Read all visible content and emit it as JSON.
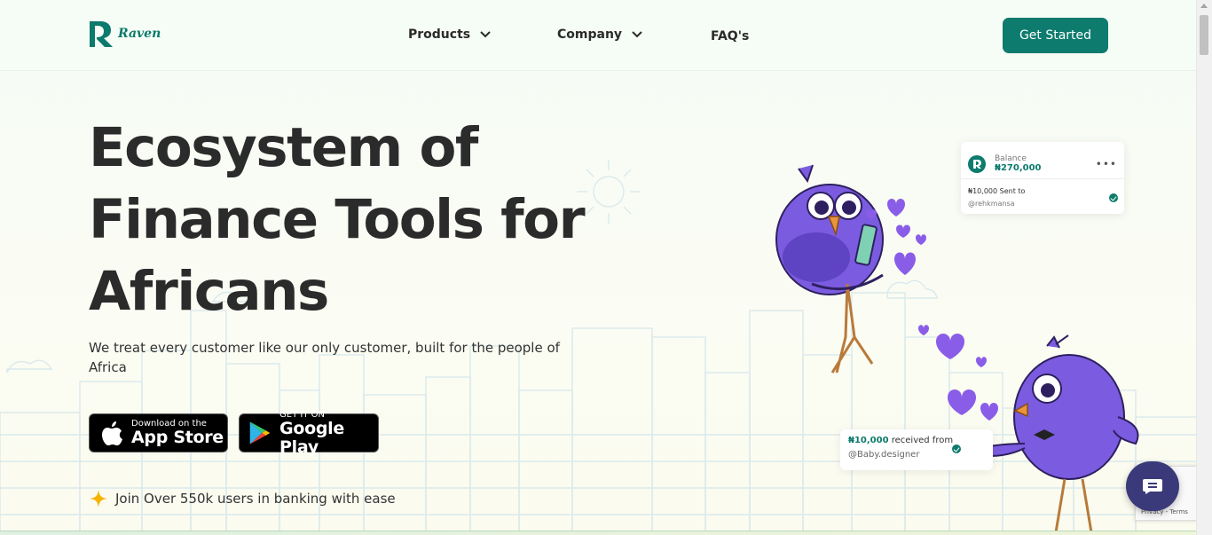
{
  "brand": {
    "name": "Raven",
    "color": "#0d7b6d"
  },
  "nav": {
    "items": [
      {
        "label": "Products",
        "has_dropdown": true
      },
      {
        "label": "Company",
        "has_dropdown": true
      },
      {
        "label": "FAQ's",
        "has_dropdown": false
      }
    ],
    "cta": "Get Started"
  },
  "hero": {
    "title_lines": [
      "Ecosystem of",
      "Finance Tools for",
      "Africans"
    ],
    "subtitle": "We treat every customer like our only customer, built for the people of Africa",
    "app_store": {
      "small": "Download on the",
      "big": "App Store"
    },
    "google_play": {
      "small": "GET IT ON",
      "big": "Google Play"
    },
    "users_text": "Join Over 550k users in banking with ease"
  },
  "balance_card": {
    "label": "Balance",
    "amount": "₦270,000",
    "menu": "•••",
    "transaction": "₦10,000 Sent to",
    "handle": "@rehkmansa"
  },
  "received_card": {
    "amount": "₦10,000",
    "text": "received from",
    "handle": "@Baby.designer"
  },
  "recaptcha": {
    "text": "Privacy - Terms"
  },
  "icons": [
    "raven-logo-icon",
    "chevron-down-icon",
    "apple-icon",
    "google-play-icon",
    "sparkle-icon",
    "check-icon",
    "chat-icon"
  ]
}
